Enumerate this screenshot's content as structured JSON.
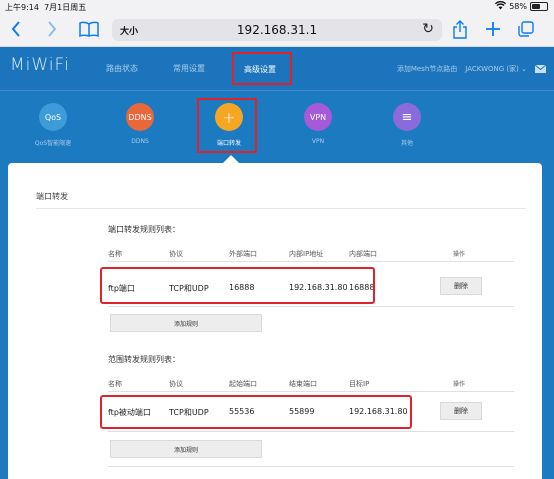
{
  "status_bar": {
    "time": "上午9:14",
    "date": "7月1日周五",
    "battery": "58%",
    "battery_level": 0.58
  },
  "browser": {
    "text_size_label": "大小",
    "url": "192.168.31.1",
    "icons": [
      "back-icon",
      "forward-icon",
      "bookmarks-icon",
      "reload-icon",
      "share-icon",
      "new-tab-icon",
      "tabs-icon"
    ]
  },
  "header": {
    "logo": "MiWiFi",
    "nav": [
      {
        "label": "路由状态"
      },
      {
        "label": "常用设置"
      },
      {
        "label": "高级设置",
        "active": true
      }
    ],
    "mesh_link": "添加Mesh节点路由",
    "user": "JACKWONG (家)",
    "accent": "#1c75bc"
  },
  "features": [
    {
      "icon_text": "QoS",
      "label": "QoS智能限速",
      "color": "#3d9bd8"
    },
    {
      "icon_text": "DDNS",
      "label": "DDNS",
      "color": "#e8683a"
    },
    {
      "icon_text": "+",
      "label": "端口转发",
      "color": "#f5a623",
      "active": true
    },
    {
      "icon_text": "VPN",
      "label": "VPN",
      "color": "#a45ad9"
    },
    {
      "icon_text": "≡",
      "label": "其他",
      "color": "#8b6bdc"
    }
  ],
  "panel": {
    "title": "端口转发",
    "port_rules": {
      "title": "端口转发规则列表：",
      "headers": [
        "名称",
        "协议",
        "外部端口",
        "内部IP地址",
        "内部端口",
        "操作"
      ],
      "rows": [
        {
          "name": "ftp端口",
          "protocol": "TCP和UDP",
          "ext_port": "16888",
          "ip": "192.168.31.80",
          "int_port": "16888",
          "action": "删除"
        }
      ],
      "add_label": "添加规则"
    },
    "range_rules": {
      "title": "范围转发规则列表：",
      "headers": [
        "名称",
        "协议",
        "起始端口",
        "结束端口",
        "目标IP",
        "操作"
      ],
      "rows": [
        {
          "name": "ftp被动端口",
          "protocol": "TCP和UDP",
          "start": "55536",
          "end": "55899",
          "ip": "192.168.31.80",
          "action": "删除"
        }
      ],
      "add_label": "添加规则"
    }
  }
}
